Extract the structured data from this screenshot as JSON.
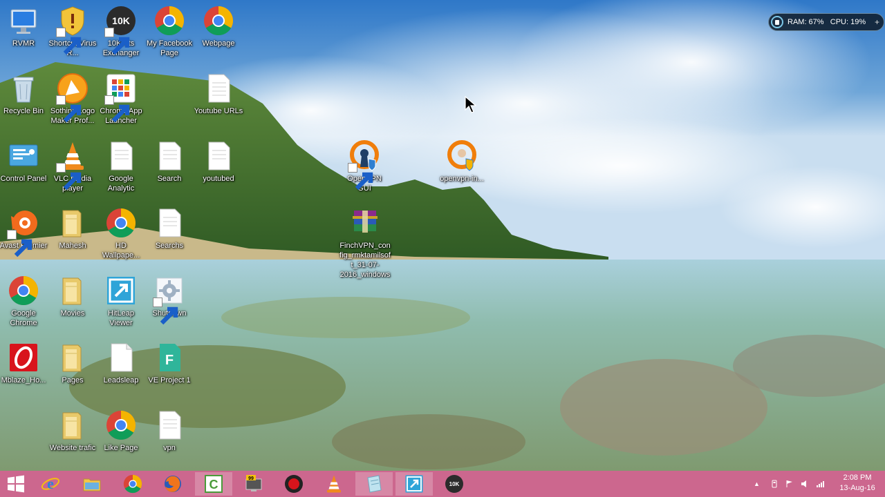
{
  "desktop": {
    "icons": [
      {
        "label": "RVMR",
        "icon": "monitor-icon"
      },
      {
        "label": "Shortcut Virus R...",
        "icon": "shield-icon"
      },
      {
        "label": "10KHits Exchanger",
        "icon": "10k-icon",
        "badge": "10K"
      },
      {
        "label": "My Facebook Page",
        "icon": "chrome-icon"
      },
      {
        "label": "Webpage",
        "icon": "chrome-icon"
      },
      {
        "label": "Recycle Bin",
        "icon": "recycle-bin-icon"
      },
      {
        "label": "Sothink Logo Maker Prof...",
        "icon": "sothink-logo-icon"
      },
      {
        "label": "Chrome App Launcher",
        "icon": "app-launcher-icon"
      },
      {
        "label": "Youtube URLs",
        "icon": "text-file-icon"
      },
      {
        "label": "Control Panel",
        "icon": "control-panel-icon"
      },
      {
        "label": "VLC media player",
        "icon": "vlc-icon"
      },
      {
        "label": "Google Analytic",
        "icon": "text-file-icon"
      },
      {
        "label": "Search",
        "icon": "text-file-icon"
      },
      {
        "label": "youtubed",
        "icon": "text-file-icon"
      },
      {
        "label": "OpenVPN GUI",
        "icon": "openvpn-icon"
      },
      {
        "label": "openvpn-in...",
        "icon": "openvpn-installer-icon"
      },
      {
        "label": "Avast Premier",
        "icon": "avast-icon"
      },
      {
        "label": "Mahesh",
        "icon": "folder-icon"
      },
      {
        "label": "HD Wallpape...",
        "icon": "chrome-icon"
      },
      {
        "label": "Searchs",
        "icon": "text-file-icon"
      },
      {
        "label": "FinchVPN_config_rmktamilsoft_31-07-2016_windows",
        "icon": "winrar-archive-icon"
      },
      {
        "label": "Google Chrome",
        "icon": "chrome-icon"
      },
      {
        "label": "Movies",
        "icon": "folder-icon"
      },
      {
        "label": "HitLeap Viewer",
        "icon": "hitleap-icon"
      },
      {
        "label": "Shutdown",
        "icon": "shutdown-gear-icon"
      },
      {
        "label": "Mblaze_Ho...",
        "icon": "mblaze-icon"
      },
      {
        "label": "Pages",
        "icon": "folder-icon"
      },
      {
        "label": "Leadsleap",
        "icon": "blank-file-icon"
      },
      {
        "label": "VE Project 1",
        "icon": "ve-project-icon",
        "badge": "F"
      },
      {
        "label": "Website trafic",
        "icon": "folder-icon"
      },
      {
        "label": "Like Page",
        "icon": "chrome-icon"
      },
      {
        "label": "vpn",
        "icon": "text-file-icon"
      }
    ]
  },
  "system_monitor": {
    "ram": "RAM: 67%",
    "cpu": "CPU: 19%",
    "plus": "+"
  },
  "taskbar": {
    "start_icon": "windows-start-icon",
    "pinned": [
      {
        "name": "internet-explorer-icon"
      },
      {
        "name": "file-explorer-icon"
      },
      {
        "name": "chrome-icon"
      },
      {
        "name": "firefox-icon"
      },
      {
        "name": "camtasia-icon"
      },
      {
        "name": "monitor-app-icon",
        "badge": "99"
      },
      {
        "name": "record-button-icon"
      },
      {
        "name": "vlc-icon"
      },
      {
        "name": "notepad-icon"
      },
      {
        "name": "hitleap-icon"
      },
      {
        "name": "10k-icon",
        "badge": "10K"
      }
    ],
    "tray": {
      "show_hidden": "▲",
      "clock_time": "2:08 PM",
      "clock_date": "13-Aug-16"
    }
  },
  "colors": {
    "taskbar": "#c03c6e",
    "chrome_red": "#db4437",
    "chrome_green": "#0f9d58",
    "chrome_yellow": "#f4b400",
    "chrome_blue": "#4285f4",
    "folder": "#e8c96a",
    "vlc_orange": "#f08a1c",
    "openvpn_orange": "#f07e0b"
  }
}
